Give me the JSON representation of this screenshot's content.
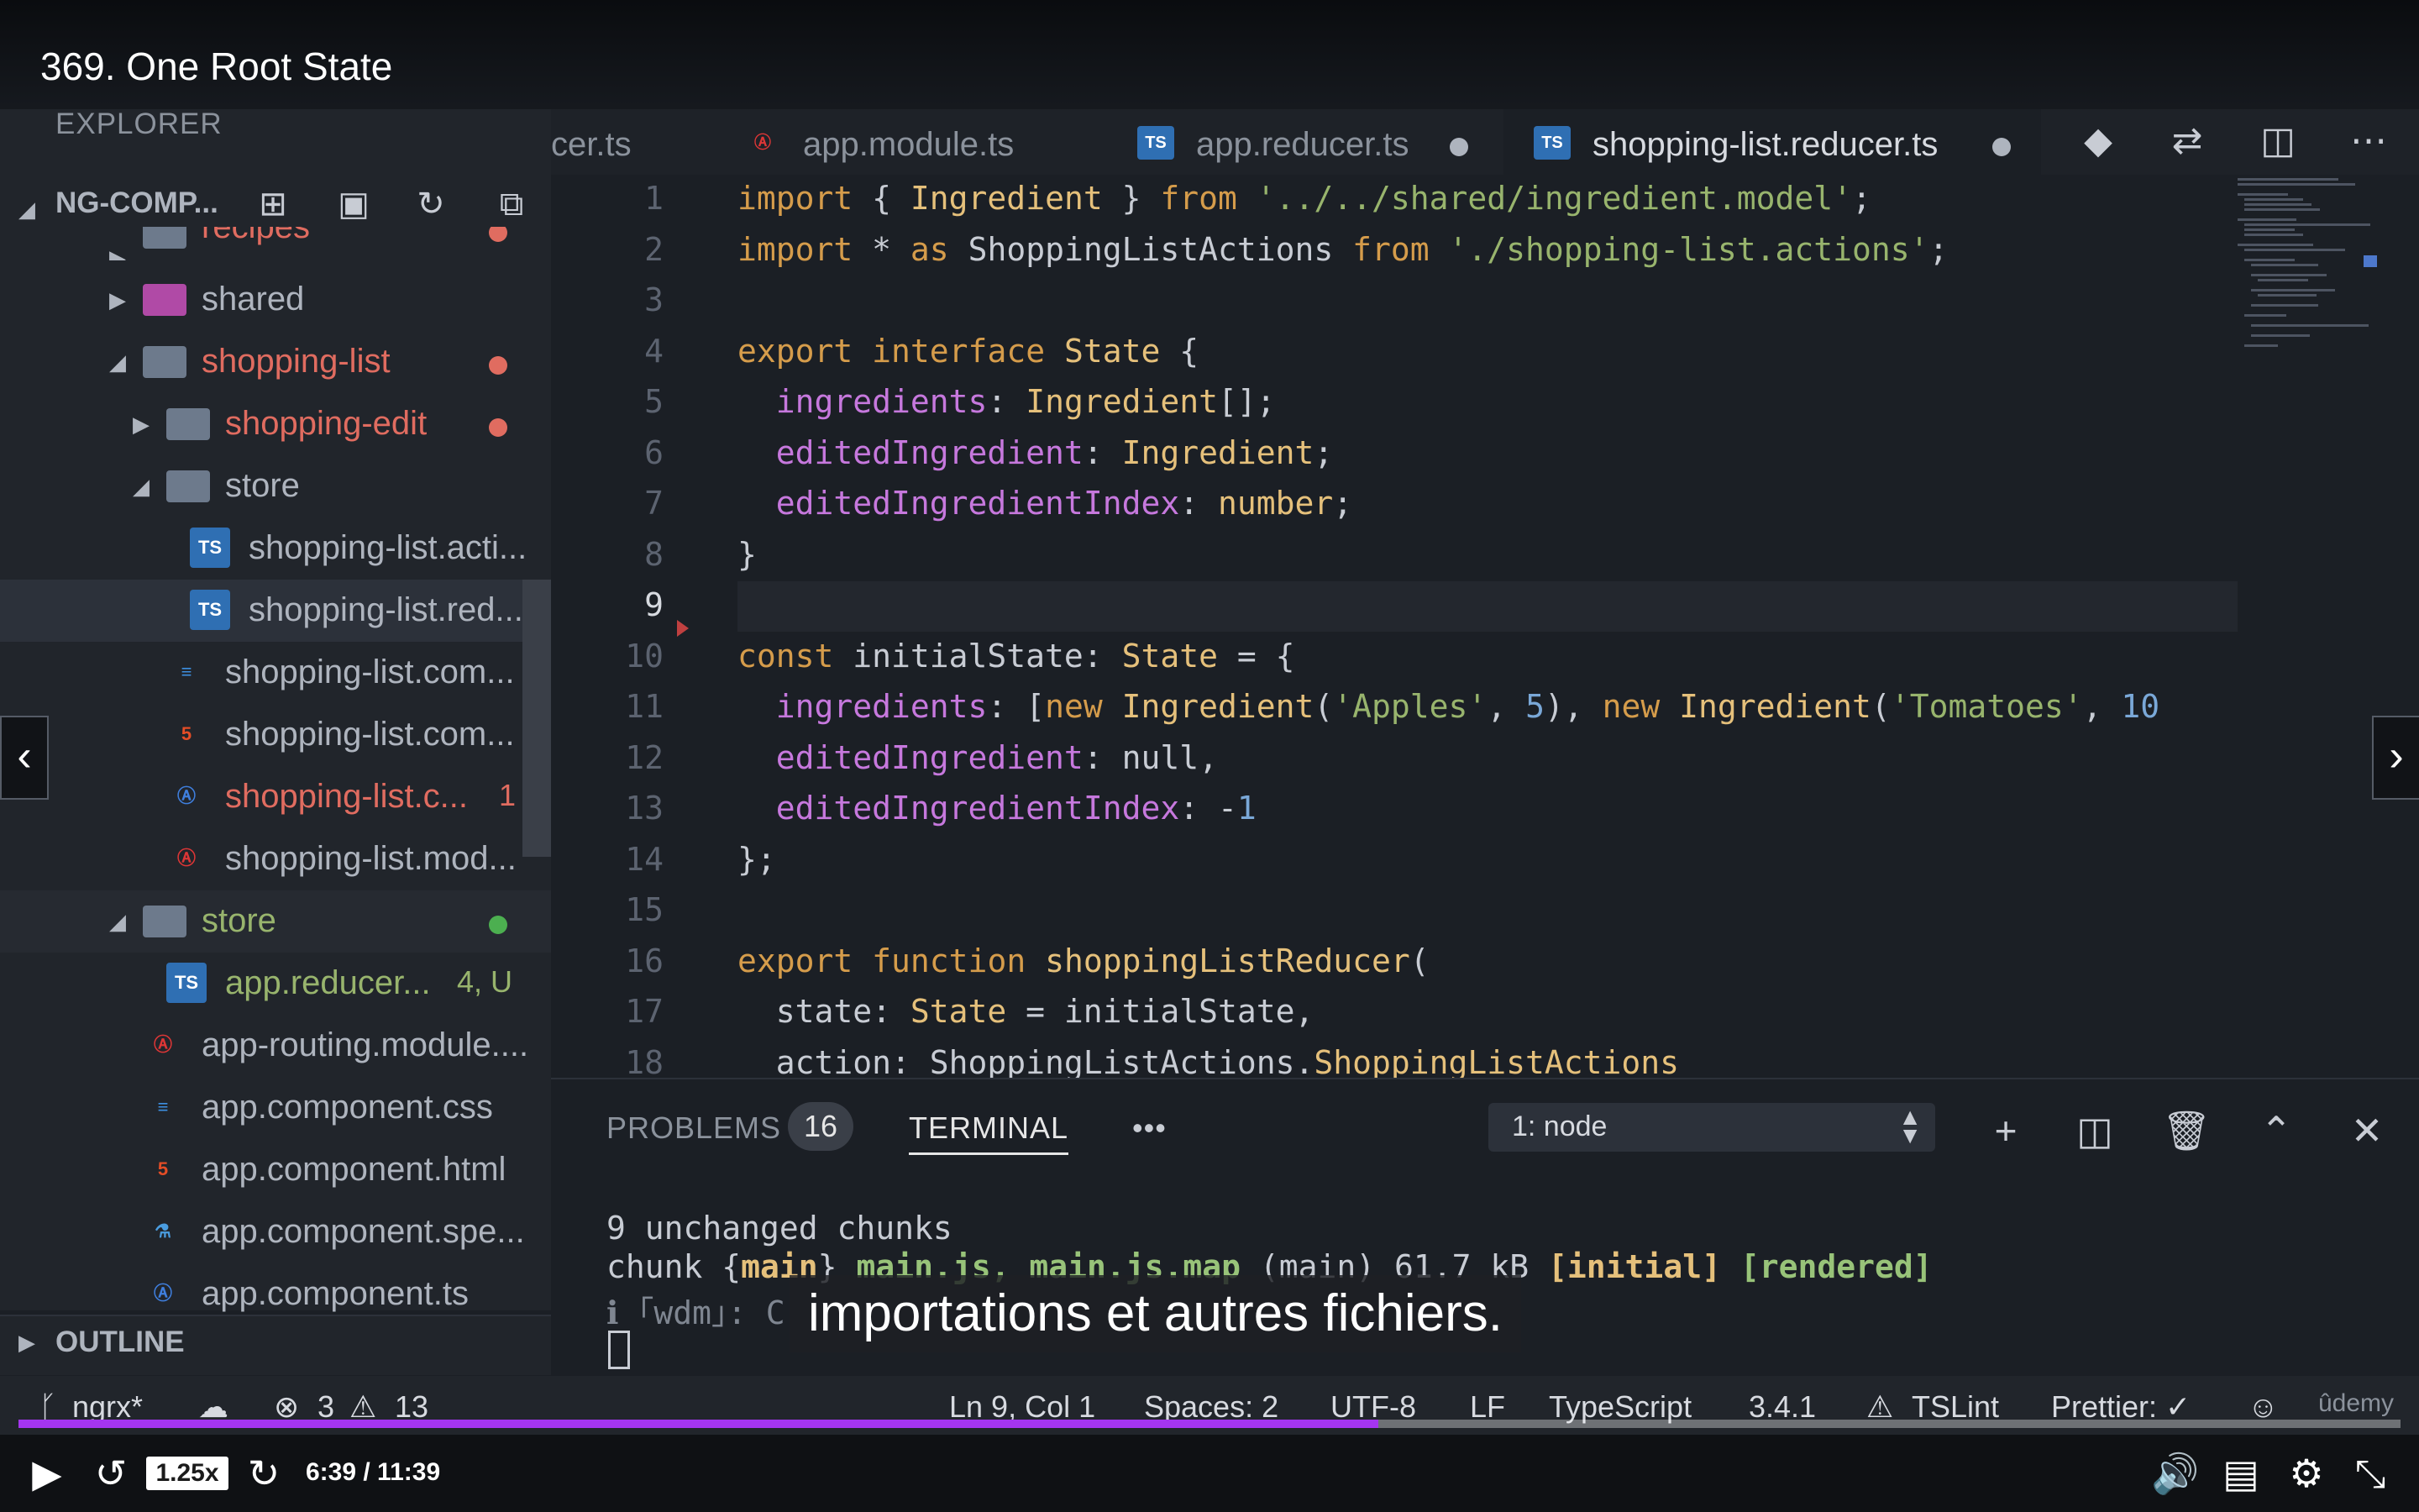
{
  "video": {
    "title": "369. One Root State",
    "speed": "1.25x",
    "time": "6:39 / 11:39",
    "progress_fraction": 0.571,
    "subtitle": "importations et autres fichiers.",
    "watermark": "ûdemy"
  },
  "sidebar": {
    "header": "EXPLORER",
    "project": "NG-COMP...",
    "outline": "OUTLINE",
    "tree": [
      {
        "label": "recipes",
        "type": "folder",
        "color": "#e06c60"
      },
      {
        "label": "shared",
        "type": "folder",
        "color": "#aeb4be"
      },
      {
        "label": "shopping-list",
        "type": "folder",
        "color": "#e06c60"
      },
      {
        "label": "shopping-edit",
        "type": "folder",
        "color": "#e06c60"
      },
      {
        "label": "store",
        "type": "folder",
        "color": "#aeb4be"
      },
      {
        "label": "shopping-list.acti...",
        "type": "ts",
        "color": "#aeb4be"
      },
      {
        "label": "shopping-list.red...",
        "type": "ts",
        "color": "#aeb4be"
      },
      {
        "label": "shopping-list.com...",
        "type": "css",
        "color": "#aeb4be"
      },
      {
        "label": "shopping-list.com...",
        "type": "html",
        "color": "#aeb4be"
      },
      {
        "label": "shopping-list.c...",
        "badge": "1",
        "type": "angular",
        "color": "#e06c60"
      },
      {
        "label": "shopping-list.mod...",
        "type": "angular-red",
        "color": "#aeb4be"
      },
      {
        "label": "store",
        "type": "folder",
        "color": "#98b46d"
      },
      {
        "label": "app.reducer...",
        "badge": "4, U",
        "type": "ts",
        "color": "#98b46d"
      },
      {
        "label": "app-routing.module....",
        "type": "angular-red",
        "color": "#aeb4be"
      },
      {
        "label": "app.component.css",
        "type": "css",
        "color": "#aeb4be"
      },
      {
        "label": "app.component.html",
        "type": "html",
        "color": "#aeb4be"
      },
      {
        "label": "app.component.spe...",
        "type": "test",
        "color": "#aeb4be"
      },
      {
        "label": "app.component.ts",
        "type": "angular",
        "color": "#aeb4be"
      }
    ]
  },
  "tabs": [
    {
      "label": "cer.ts"
    },
    {
      "label": "app.module.ts"
    },
    {
      "label": "app.reducer.ts"
    },
    {
      "label": "shopping-list.reducer.ts"
    }
  ],
  "editor": {
    "line_numbers": [
      "1",
      "2",
      "3",
      "4",
      "5",
      "6",
      "7",
      "8",
      "9",
      "10",
      "11",
      "12",
      "13",
      "14",
      "15",
      "16",
      "17",
      "18"
    ],
    "lines": [
      "import { Ingredient } from '../../shared/ingredient.model';",
      "import * as ShoppingListActions from './shopping-list.actions';",
      "",
      "export interface State {",
      "  ingredients: Ingredient[];",
      "  editedIngredient: Ingredient;",
      "  editedIngredientIndex: number;",
      "}",
      "",
      "const initialState: State = {",
      "  ingredients: [new Ingredient('Apples', 5), new Ingredient('Tomatoes', 10",
      "  editedIngredient: null,",
      "  editedIngredientIndex: -1",
      "};",
      "",
      "export function shoppingListReducer(",
      "  state: State = initialState,",
      "  action: ShoppingListActions.ShoppingListActions"
    ]
  },
  "panel": {
    "problems_label": "PROBLEMS",
    "problems_count": "16",
    "terminal_label": "TERMINAL",
    "more": "•••",
    "terminal_select": "1: node",
    "terminal_lines": [
      "9 unchanged chunks",
      "chunk {main} main.js, main.js.map (main) 61.7 kB [initial] [rendered]",
      "ℹ ｢wdm｣: C"
    ]
  },
  "statusbar": {
    "branch": "ngrx*",
    "errors": "3",
    "warnings": "13",
    "position": "Ln 9, Col 1",
    "spaces": "Spaces: 2",
    "encoding": "UTF-8",
    "eol": "LF",
    "language": "TypeScript",
    "version": "3.4.1",
    "lint": "TSLint",
    "prettier": "Prettier: ✓"
  }
}
